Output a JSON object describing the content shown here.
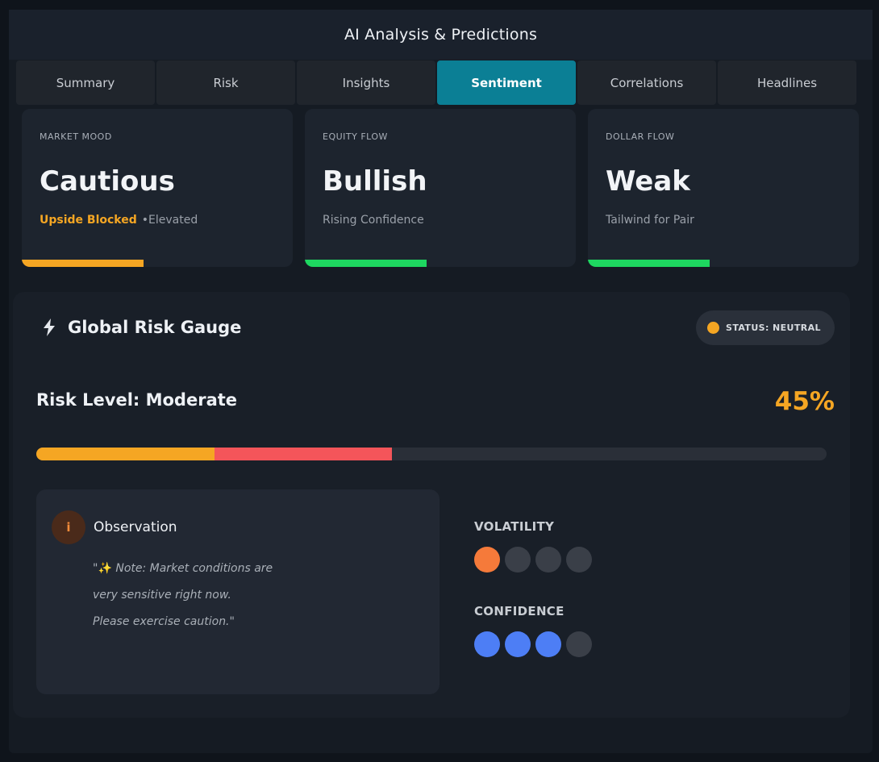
{
  "app": {
    "title": "AI Analysis & Predictions"
  },
  "tabs": [
    {
      "label": "Summary",
      "active": false
    },
    {
      "label": "Risk",
      "active": false
    },
    {
      "label": "Insights",
      "active": false
    },
    {
      "label": "Sentiment",
      "active": true
    },
    {
      "label": "Correlations",
      "active": false
    },
    {
      "label": "Headlines",
      "active": false
    }
  ],
  "cards": [
    {
      "label": "MARKET MOOD",
      "value": "Cautious",
      "highlight": "Upside Blocked",
      "extra": "•Elevated",
      "subtitle": "",
      "bar_color": "#f5a623",
      "bar_fill": 0.45
    },
    {
      "label": "EQUITY FLOW",
      "value": "Bullish",
      "highlight": "",
      "extra": "",
      "subtitle": "Rising Confidence",
      "bar_color": "#1ed760",
      "bar_fill": 0.45
    },
    {
      "label": "DOLLAR FLOW",
      "value": "Weak",
      "highlight": "",
      "extra": "",
      "subtitle": "Tailwind for Pair",
      "bar_color": "#1ed760",
      "bar_fill": 0.45
    }
  ],
  "gauge": {
    "title": "Global Risk Gauge",
    "icon": "bolt-icon",
    "status": "STATUS: NEUTRAL",
    "status_color": "#f5a623",
    "risk_label": "Risk Level: Moderate",
    "risk_percent": "45%",
    "risk_value": 45,
    "segments": [
      {
        "color": "#f5a623",
        "fraction": 0.225
      },
      {
        "color": "#f4555a",
        "fraction": 0.225
      }
    ]
  },
  "observation": {
    "title": "Observation",
    "icon": "info-icon",
    "icon_glyph": "i",
    "sparkle": "✨",
    "lines": [
      "\" Note: Market conditions are",
      "very sensitive right now.",
      "Please exercise caution.\""
    ]
  },
  "metrics": [
    {
      "label": "VOLATILITY",
      "filled": 1,
      "total": 4,
      "color": "#f57a3a"
    },
    {
      "label": "CONFIDENCE",
      "filled": 3,
      "total": 4,
      "color": "#4d7ef5"
    }
  ]
}
